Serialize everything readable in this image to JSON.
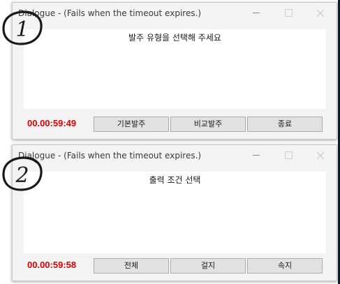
{
  "dialogs": [
    {
      "title": "Dialogue - (Fails when the timeout expires.)",
      "message": "발주 유형을 선택해 주세요",
      "timer": "00.00:59:49",
      "buttons": [
        "기본발주",
        "비교발주",
        "종료"
      ]
    },
    {
      "title": "Dialogue - (Fails when the timeout expires.)",
      "message": "출력 조건 선택",
      "timer": "00.00:59:58",
      "buttons": [
        "전체",
        "걸지",
        "속지"
      ]
    }
  ],
  "annotations": [
    "1",
    "2"
  ],
  "colors": {
    "timer": "#e00000",
    "dialog_bg": "#f3f3f3",
    "button_bg": "#e1e1e1",
    "content_bg": "#ffffff"
  },
  "icons": {
    "minimize": "minimize-icon",
    "maximize": "maximize-icon",
    "close": "close-icon"
  }
}
